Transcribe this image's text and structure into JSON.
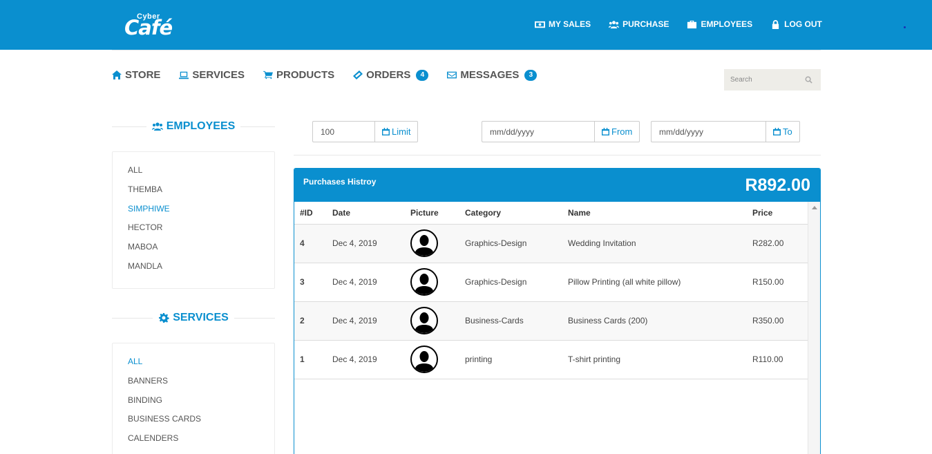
{
  "brand": {
    "small": "Cyber",
    "big": "Café"
  },
  "topnav": [
    {
      "label": "MY SALES",
      "icon": "money-icon"
    },
    {
      "label": "PURCHASE",
      "icon": "users-icon"
    },
    {
      "label": "EMPLOYEES",
      "icon": "briefcase-icon"
    },
    {
      "label": "LOG OUT",
      "icon": "lock-icon"
    }
  ],
  "mainnav": [
    {
      "label": "STORE",
      "icon": "home-icon"
    },
    {
      "label": "SERVICES",
      "icon": "laptop-icon"
    },
    {
      "label": "PRODUCTS",
      "icon": "cart-icon"
    },
    {
      "label": "ORDERS",
      "icon": "ticket-icon",
      "badge": "4"
    },
    {
      "label": "MESSAGES",
      "icon": "envelope-icon",
      "badge": "3"
    }
  ],
  "search": {
    "placeholder": "Search"
  },
  "sidebar": {
    "employees": {
      "title": "EMPLOYEES",
      "items": [
        "ALL",
        "THEMBA",
        "SIMPHIWE",
        "HECTOR",
        "MABOA",
        "MANDLA"
      ],
      "active": "SIMPHIWE"
    },
    "services": {
      "title": "SERVICES",
      "items": [
        "ALL",
        "BANNERS",
        "BINDING",
        "BUSINESS CARDS",
        "CALENDERS"
      ],
      "active": "ALL"
    }
  },
  "filters": {
    "limit": {
      "value": "100",
      "button": "Limit"
    },
    "from": {
      "placeholder": "mm/dd/yyyy",
      "button": "From"
    },
    "to": {
      "placeholder": "mm/dd/yyyy",
      "button": "To"
    }
  },
  "panel": {
    "title": "Purchases Histroy",
    "total": "R892.00",
    "columns": [
      "#ID",
      "Date",
      "Picture",
      "Category",
      "Name",
      "Price"
    ],
    "rows": [
      {
        "id": "4",
        "date": "Dec 4, 2019",
        "category": "Graphics-Design",
        "name": "Wedding Invitation",
        "price": "R282.00"
      },
      {
        "id": "3",
        "date": "Dec 4, 2019",
        "category": "Graphics-Design",
        "name": "Pillow Printing (all white pillow)",
        "price": "R150.00"
      },
      {
        "id": "2",
        "date": "Dec 4, 2019",
        "category": "Business-Cards",
        "name": "Business Cards (200)",
        "price": "R350.00"
      },
      {
        "id": "1",
        "date": "Dec 4, 2019",
        "category": "printing",
        "name": "T-shirt printing",
        "price": "R110.00"
      }
    ]
  },
  "colors": {
    "primary": "#0a8fcf",
    "search_bg": "#eeede8"
  }
}
